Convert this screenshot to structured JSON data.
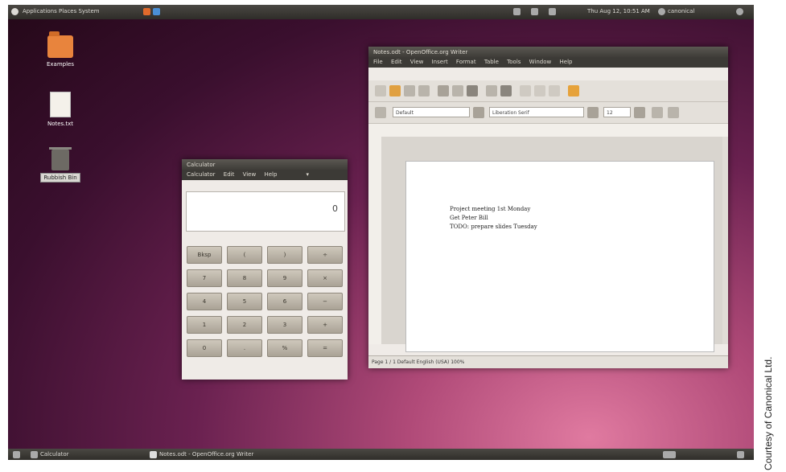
{
  "top_panel": {
    "menus": "Applications  Places  System",
    "time": "Thu Aug 12, 10:51 AM",
    "user": "canonical"
  },
  "desktop_icons": [
    {
      "label": "Examples",
      "icon": "folder-icon",
      "selected": false
    },
    {
      "label": "Notes.txt",
      "icon": "document-icon",
      "selected": false
    },
    {
      "label": "Rubbish Bin",
      "icon": "trash-icon",
      "selected": true
    }
  ],
  "calculator": {
    "title": "Calculator",
    "menu": [
      "Calculator",
      "Edit",
      "View",
      "Help"
    ],
    "display_value": "0",
    "keys": [
      "Bksp",
      "(",
      ")",
      "÷",
      "7",
      "8",
      "9",
      "×",
      "4",
      "5",
      "6",
      "−",
      "1",
      "2",
      "3",
      "+",
      "0",
      ".",
      "%",
      "="
    ]
  },
  "writer": {
    "title": "Notes.odt - OpenOffice.org Writer",
    "menu": [
      "File",
      "Edit",
      "View",
      "Insert",
      "Format",
      "Table",
      "Tools",
      "Window",
      "Help"
    ],
    "style_field": "Default",
    "font_field": "Liberation Serif",
    "size_field": "12",
    "lines": [
      "Project meeting 1st Monday",
      "Get Peter Bill",
      "TODO: prepare slides Tuesday"
    ],
    "status": "Page 1 / 1   Default   English (USA)   100%"
  },
  "bottom_panel": {
    "items": [
      "Calculator",
      "Notes.odt - OpenOffice.org Writer"
    ]
  },
  "credit": "Courtesy of Canonical Ltd."
}
